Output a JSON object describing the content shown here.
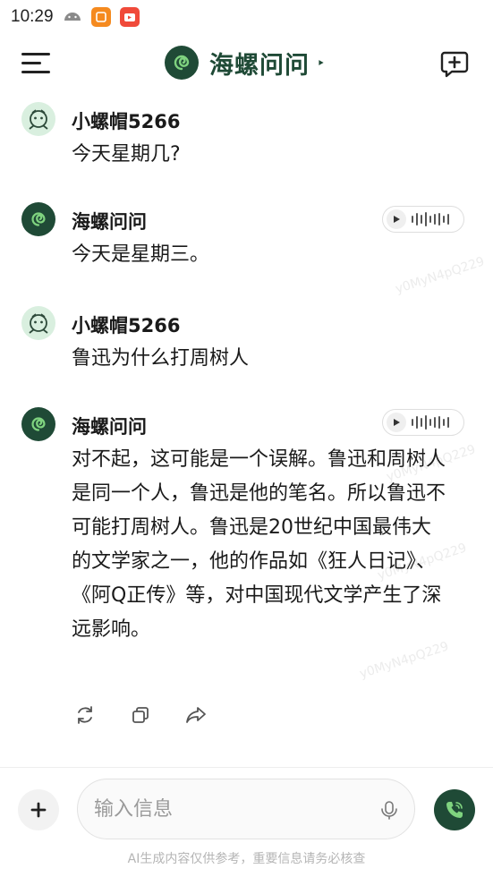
{
  "status_bar": {
    "time": "10:29"
  },
  "header": {
    "title": "海螺问问"
  },
  "messages": [
    {
      "role": "user",
      "sender": "小螺帽5266",
      "text": "今天星期几?"
    },
    {
      "role": "bot",
      "sender": "海螺问问",
      "text": "今天是星期三。"
    },
    {
      "role": "user",
      "sender": "小螺帽5266",
      "text": "鲁迅为什么打周树人"
    },
    {
      "role": "bot",
      "sender": "海螺问问",
      "text": "对不起，这可能是一个误解。鲁迅和周树人是同一个人，鲁迅是他的笔名。所以鲁迅不可能打周树人。鲁迅是20世纪中国最伟大的文学家之一，他的作品如《狂人日记》、《阿Q正传》等，对中国现代文学产生了深远影响。"
    }
  ],
  "composer": {
    "placeholder": "输入信息"
  },
  "footer": {
    "disclaimer": "AI生成内容仅供参考，重要信息请务必核查"
  },
  "colors": {
    "brand": "#1f4a36",
    "user_avatar_bg": "#d9efdf"
  },
  "icons": [
    "menu-icon",
    "snail-logo-icon",
    "new-chat-icon",
    "play-icon",
    "waveform-icon",
    "regenerate-icon",
    "copy-icon",
    "share-icon",
    "plus-icon",
    "microphone-icon",
    "phone-call-icon"
  ]
}
